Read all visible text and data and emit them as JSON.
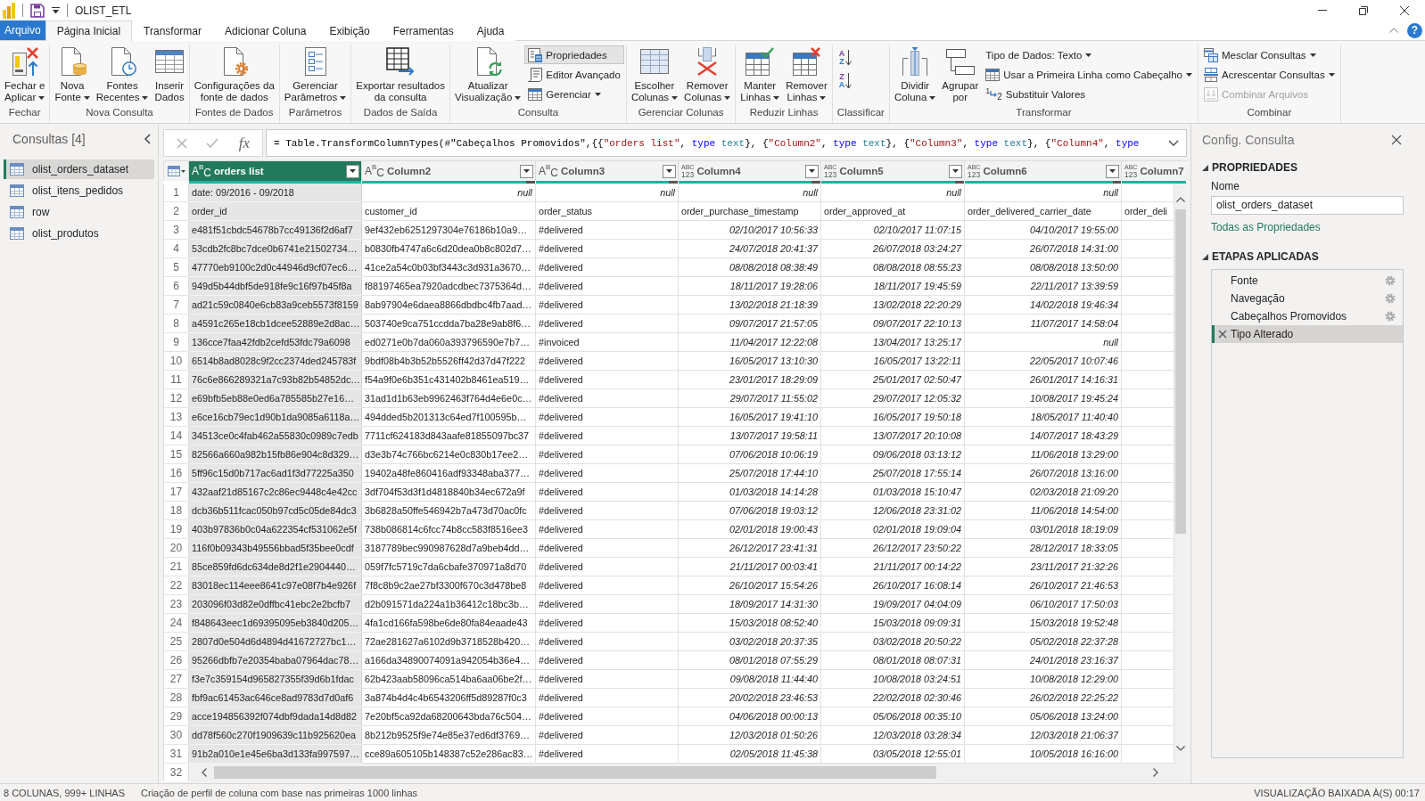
{
  "window": {
    "title": "OLIST_ETL"
  },
  "ribbon": {
    "tabs": [
      {
        "label": "Arquivo",
        "kind": "file",
        "selected": false
      },
      {
        "label": "Página Inicial",
        "kind": "tab",
        "selected": true
      },
      {
        "label": "Transformar",
        "kind": "tab",
        "selected": false
      },
      {
        "label": "Adicionar Coluna",
        "kind": "tab",
        "selected": false
      },
      {
        "label": "Exibição",
        "kind": "tab",
        "selected": false
      },
      {
        "label": "Ferramentas",
        "kind": "tab",
        "selected": false
      },
      {
        "label": "Ajuda",
        "kind": "tab",
        "selected": false
      }
    ],
    "help_symbol": "?",
    "groups": [
      {
        "label": "Fechar",
        "commands": [
          {
            "kind": "large",
            "lines": [
              "Fechar e",
              "Aplicar"
            ],
            "dropdown": true,
            "disabled": false,
            "highlighted": false
          }
        ]
      },
      {
        "label": "Nova Consulta",
        "commands": [
          {
            "kind": "large",
            "lines": [
              "Nova",
              "Fonte"
            ],
            "dropdown": true,
            "disabled": false,
            "highlighted": false
          },
          {
            "kind": "large",
            "lines": [
              "Fontes",
              "Recentes"
            ],
            "dropdown": true,
            "disabled": false,
            "highlighted": false
          },
          {
            "kind": "large",
            "lines": [
              "Inserir",
              "Dados"
            ],
            "dropdown": false,
            "disabled": false,
            "highlighted": false
          }
        ]
      },
      {
        "label": "Fontes de Dados",
        "commands": [
          {
            "kind": "large",
            "lines": [
              "Configurações da",
              "fonte de dados"
            ],
            "dropdown": false,
            "disabled": false,
            "highlighted": false
          }
        ]
      },
      {
        "label": "Parâmetros",
        "commands": [
          {
            "kind": "large",
            "lines": [
              "Gerenciar",
              "Parâmetros"
            ],
            "dropdown": true,
            "disabled": false,
            "highlighted": false
          }
        ]
      },
      {
        "label": "Dados de Saída",
        "commands": [
          {
            "kind": "large",
            "lines": [
              "Exportar resultados",
              "da consulta"
            ],
            "dropdown": false,
            "disabled": false,
            "highlighted": false
          }
        ]
      },
      {
        "label": "Consulta",
        "commands": [
          {
            "kind": "large",
            "lines": [
              "Atualizar",
              "Visualização"
            ],
            "dropdown": true,
            "disabled": false,
            "highlighted": false
          },
          {
            "kind": "small",
            "label": "Propriedades",
            "dropdown": false,
            "disabled": false,
            "highlighted": true
          },
          {
            "kind": "small",
            "label": "Editor Avançado",
            "dropdown": false,
            "disabled": false,
            "highlighted": false
          },
          {
            "kind": "small",
            "label": "Gerenciar",
            "dropdown": true,
            "disabled": false,
            "highlighted": false
          }
        ]
      },
      {
        "label": "Gerenciar Colunas",
        "commands": [
          {
            "kind": "large",
            "lines": [
              "Escolher",
              "Colunas"
            ],
            "dropdown": true,
            "disabled": false,
            "highlighted": false
          },
          {
            "kind": "large",
            "lines": [
              "Remover",
              "Colunas"
            ],
            "dropdown": true,
            "disabled": false,
            "highlighted": false
          }
        ]
      },
      {
        "label": "Reduzir Linhas",
        "commands": [
          {
            "kind": "large",
            "lines": [
              "Manter",
              "Linhas"
            ],
            "dropdown": true,
            "disabled": false,
            "highlighted": false
          },
          {
            "kind": "large",
            "lines": [
              "Remover",
              "Linhas"
            ],
            "dropdown": true,
            "disabled": false,
            "highlighted": false
          }
        ]
      },
      {
        "label": "Classificar",
        "commands": [
          {
            "kind": "sort",
            "symbol": "AZ",
            "dropdown": false,
            "disabled": false,
            "highlighted": false
          },
          {
            "kind": "sort",
            "symbol": "ZA",
            "dropdown": false,
            "disabled": false,
            "highlighted": false
          }
        ]
      },
      {
        "label": "Transformar",
        "commands": [
          {
            "kind": "large",
            "lines": [
              "Dividir",
              "Coluna"
            ],
            "dropdown": true,
            "disabled": false,
            "highlighted": false
          },
          {
            "kind": "large",
            "lines": [
              "Agrupar",
              "por"
            ],
            "dropdown": false,
            "disabled": false,
            "highlighted": false
          },
          {
            "kind": "small",
            "label": "Tipo de Dados: Texto",
            "dropdown": true,
            "disabled": false,
            "highlighted": false
          },
          {
            "kind": "small",
            "label": "Usar a Primeira Linha como Cabeçalho",
            "dropdown": true,
            "disabled": false,
            "highlighted": false
          },
          {
            "kind": "small",
            "label": "Substituir Valores",
            "symbol": "12",
            "dropdown": false,
            "disabled": false,
            "highlighted": false
          }
        ]
      },
      {
        "label": "Combinar",
        "commands": [
          {
            "kind": "small",
            "label": "Mesclar Consultas",
            "dropdown": true,
            "disabled": false,
            "highlighted": false
          },
          {
            "kind": "small",
            "label": "Acrescentar Consultas",
            "dropdown": true,
            "disabled": false,
            "highlighted": false
          },
          {
            "kind": "small",
            "label": "Combinar Arquivos",
            "dropdown": false,
            "disabled": true,
            "highlighted": false
          }
        ]
      }
    ]
  },
  "queries_pane": {
    "title": "Consultas [4]",
    "items": [
      {
        "label": "olist_orders_dataset",
        "selected": true
      },
      {
        "label": "olist_itens_pedidos",
        "selected": false
      },
      {
        "label": "row",
        "selected": false
      },
      {
        "label": "olist_produtos",
        "selected": false
      }
    ]
  },
  "formula_bar": {
    "function_symbol": "fx",
    "formula": [
      {
        "text": "= Table.TransformColumnTypes(#\"Cabeçalhos Promovidos\",{{",
        "kind": "plain"
      },
      {
        "text": "\"orders list\"",
        "kind": "string"
      },
      {
        "text": ", ",
        "kind": "plain"
      },
      {
        "text": "type",
        "kind": "keyword"
      },
      {
        "text": " text",
        "kind": "type_name"
      },
      {
        "text": "}, {",
        "kind": "plain"
      },
      {
        "text": "\"Column2\"",
        "kind": "string"
      },
      {
        "text": ", ",
        "kind": "plain"
      },
      {
        "text": "type",
        "kind": "keyword"
      },
      {
        "text": " text",
        "kind": "type_name"
      },
      {
        "text": "}, {",
        "kind": "plain"
      },
      {
        "text": "\"Column3\"",
        "kind": "string"
      },
      {
        "text": ", ",
        "kind": "plain"
      },
      {
        "text": "type",
        "kind": "keyword"
      },
      {
        "text": " text",
        "kind": "type_name"
      },
      {
        "text": "}, {",
        "kind": "plain"
      },
      {
        "text": "\"Column4\"",
        "kind": "string"
      },
      {
        "text": ", ",
        "kind": "plain"
      },
      {
        "text": "type",
        "kind": "keyword"
      }
    ]
  },
  "table": {
    "columns": [
      {
        "name": "orders list",
        "kind": "text",
        "type_symbol": "ABC",
        "selected": true,
        "quality": {
          "level": 1
        }
      },
      {
        "name": "Column2",
        "kind": "text",
        "type_symbol": "ABC",
        "selected": false,
        "quality": {
          "level": 0.95
        }
      },
      {
        "name": "Column3",
        "kind": "text",
        "type_symbol": "ABC",
        "selected": false,
        "quality": {
          "level": 0.94
        }
      },
      {
        "name": "Column4",
        "kind": "any",
        "type_symbol": "ABC 123",
        "selected": false,
        "quality": {
          "level": 0.94
        }
      },
      {
        "name": "Column5",
        "kind": "any",
        "type_symbol": "ABC 123",
        "selected": false,
        "quality": {
          "level": 0.94
        }
      },
      {
        "name": "Column6",
        "kind": "any",
        "type_symbol": "ABC 123",
        "selected": false,
        "quality": {
          "level": 0.95
        }
      }
    ],
    "cut_column": {
      "name": "Column7",
      "kind": "any",
      "type_symbol": "ABC 123",
      "selected": false,
      "quality": {
        "level": 1
      }
    },
    "rows": [
      {
        "number": "1",
        "cells": [
          {
            "text": "date: 09/2016 - 09/2018",
            "kind": "text"
          },
          {
            "text": "null",
            "kind": "null"
          },
          {
            "text": "null",
            "kind": "null"
          },
          {
            "text": "null",
            "kind": "null"
          },
          {
            "text": "null",
            "kind": "null"
          },
          {
            "text": "null",
            "kind": "null"
          }
        ]
      },
      {
        "number": "2",
        "cells": [
          {
            "text": "order_id",
            "kind": "text"
          },
          {
            "text": "customer_id",
            "kind": "text"
          },
          {
            "text": "order_status",
            "kind": "text"
          },
          {
            "text": "order_purchase_timestamp",
            "kind": "text"
          },
          {
            "text": "order_approved_at",
            "kind": "text"
          },
          {
            "text": "order_delivered_carrier_date",
            "kind": "text"
          },
          {
            "text": "order_deli",
            "kind": "text"
          }
        ]
      },
      {
        "number": "3",
        "cells": [
          {
            "text": "e481f51cbdc54678b7cc49136f2d6af7",
            "kind": "text"
          },
          {
            "text": "9ef432eb6251297304e76186b10a9…",
            "kind": "text"
          },
          {
            "text": "#delivered",
            "kind": "text"
          },
          {
            "text": "02/10/2017 10:56:33",
            "kind": "datetime"
          },
          {
            "text": "02/10/2017 11:07:15",
            "kind": "datetime"
          },
          {
            "text": "04/10/2017 19:55:00",
            "kind": "datetime"
          }
        ]
      },
      {
        "number": "4",
        "cells": [
          {
            "text": "53cdb2fc8bc7dce0b6741e21502734…",
            "kind": "text"
          },
          {
            "text": "b0830fb4747a6c6d20dea0b8c802d7…",
            "kind": "text"
          },
          {
            "text": "#delivered",
            "kind": "text"
          },
          {
            "text": "24/07/2018 20:41:37",
            "kind": "datetime"
          },
          {
            "text": "26/07/2018 03:24:27",
            "kind": "datetime"
          },
          {
            "text": "26/07/2018 14:31:00",
            "kind": "datetime"
          }
        ]
      },
      {
        "number": "5",
        "cells": [
          {
            "text": "47770eb9100c2d0c44946d9cf07ec6…",
            "kind": "text"
          },
          {
            "text": "41ce2a54c0b03bf3443c3d931a3670…",
            "kind": "text"
          },
          {
            "text": "#delivered",
            "kind": "text"
          },
          {
            "text": "08/08/2018 08:38:49",
            "kind": "datetime"
          },
          {
            "text": "08/08/2018 08:55:23",
            "kind": "datetime"
          },
          {
            "text": "08/08/2018 13:50:00",
            "kind": "datetime"
          }
        ]
      },
      {
        "number": "6",
        "cells": [
          {
            "text": "949d5b44dbf5de918fe9c16f97b45f8a",
            "kind": "text"
          },
          {
            "text": "f88197465ea7920adcdbec7375364d…",
            "kind": "text"
          },
          {
            "text": "#delivered",
            "kind": "text"
          },
          {
            "text": "18/11/2017 19:28:06",
            "kind": "datetime"
          },
          {
            "text": "18/11/2017 19:45:59",
            "kind": "datetime"
          },
          {
            "text": "22/11/2017 13:39:59",
            "kind": "datetime"
          }
        ]
      },
      {
        "number": "7",
        "cells": [
          {
            "text": "ad21c59c0840e6cb83a9ceb5573f8159",
            "kind": "text"
          },
          {
            "text": "8ab97904e6daea8866dbdbc4fb7aad…",
            "kind": "text"
          },
          {
            "text": "#delivered",
            "kind": "text"
          },
          {
            "text": "13/02/2018 21:18:39",
            "kind": "datetime"
          },
          {
            "text": "13/02/2018 22:20:29",
            "kind": "datetime"
          },
          {
            "text": "14/02/2018 19:46:34",
            "kind": "datetime"
          }
        ]
      },
      {
        "number": "8",
        "cells": [
          {
            "text": "a4591c265e18cb1dcee52889e2d8ac…",
            "kind": "text"
          },
          {
            "text": "503740e9ca751ccdda7ba28e9ab8f6…",
            "kind": "text"
          },
          {
            "text": "#delivered",
            "kind": "text"
          },
          {
            "text": "09/07/2017 21:57:05",
            "kind": "datetime"
          },
          {
            "text": "09/07/2017 22:10:13",
            "kind": "datetime"
          },
          {
            "text": "11/07/2017 14:58:04",
            "kind": "datetime"
          }
        ]
      },
      {
        "number": "9",
        "cells": [
          {
            "text": "136cce7faa42fdb2cefd53fdc79a6098",
            "kind": "text"
          },
          {
            "text": "ed0271e0b7da060a393796590e7b7…",
            "kind": "text"
          },
          {
            "text": "#invoiced",
            "kind": "text"
          },
          {
            "text": "11/04/2017 12:22:08",
            "kind": "datetime"
          },
          {
            "text": "13/04/2017 13:25:17",
            "kind": "datetime"
          },
          {
            "text": "null",
            "kind": "null"
          }
        ]
      },
      {
        "number": "10",
        "cells": [
          {
            "text": "6514b8ad8028c9f2cc2374ded245783f",
            "kind": "text"
          },
          {
            "text": "9bdf08b4b3b52b5526ff42d37d47f222",
            "kind": "text"
          },
          {
            "text": "#delivered",
            "kind": "text"
          },
          {
            "text": "16/05/2017 13:10:30",
            "kind": "datetime"
          },
          {
            "text": "16/05/2017 13:22:11",
            "kind": "datetime"
          },
          {
            "text": "22/05/2017 10:07:46",
            "kind": "datetime"
          }
        ]
      },
      {
        "number": "11",
        "cells": [
          {
            "text": "76c6e866289321a7c93b82b54852dc…",
            "kind": "text"
          },
          {
            "text": "f54a9f0e6b351c431402b8461ea519…",
            "kind": "text"
          },
          {
            "text": "#delivered",
            "kind": "text"
          },
          {
            "text": "23/01/2017 18:29:09",
            "kind": "datetime"
          },
          {
            "text": "25/01/2017 02:50:47",
            "kind": "datetime"
          },
          {
            "text": "26/01/2017 14:16:31",
            "kind": "datetime"
          }
        ]
      },
      {
        "number": "12",
        "cells": [
          {
            "text": "e69bfb5eb88e0ed6a785585b27e16…",
            "kind": "text"
          },
          {
            "text": "31ad1d1b63eb9962463f764d4e6e0c…",
            "kind": "text"
          },
          {
            "text": "#delivered",
            "kind": "text"
          },
          {
            "text": "29/07/2017 11:55:02",
            "kind": "datetime"
          },
          {
            "text": "29/07/2017 12:05:32",
            "kind": "datetime"
          },
          {
            "text": "10/08/2017 19:45:24",
            "kind": "datetime"
          }
        ]
      },
      {
        "number": "13",
        "cells": [
          {
            "text": "e6ce16cb79ec1d90b1da9085a6118a…",
            "kind": "text"
          },
          {
            "text": "494dded5b201313c64ed7f100595b…",
            "kind": "text"
          },
          {
            "text": "#delivered",
            "kind": "text"
          },
          {
            "text": "16/05/2017 19:41:10",
            "kind": "datetime"
          },
          {
            "text": "16/05/2017 19:50:18",
            "kind": "datetime"
          },
          {
            "text": "18/05/2017 11:40:40",
            "kind": "datetime"
          }
        ]
      },
      {
        "number": "14",
        "cells": [
          {
            "text": "34513ce0c4fab462a55830c0989c7edb",
            "kind": "text"
          },
          {
            "text": "7711cf624183d843aafe81855097bc37",
            "kind": "text"
          },
          {
            "text": "#delivered",
            "kind": "text"
          },
          {
            "text": "13/07/2017 19:58:11",
            "kind": "datetime"
          },
          {
            "text": "13/07/2017 20:10:08",
            "kind": "datetime"
          },
          {
            "text": "14/07/2017 18:43:29",
            "kind": "datetime"
          }
        ]
      },
      {
        "number": "15",
        "cells": [
          {
            "text": "82566a660a982b15fb86e904c8d329…",
            "kind": "text"
          },
          {
            "text": "d3e3b74c766bc6214e0c830b17ee2…",
            "kind": "text"
          },
          {
            "text": "#delivered",
            "kind": "text"
          },
          {
            "text": "07/06/2018 10:06:19",
            "kind": "datetime"
          },
          {
            "text": "09/06/2018 03:13:12",
            "kind": "datetime"
          },
          {
            "text": "11/06/2018 13:29:00",
            "kind": "datetime"
          }
        ]
      },
      {
        "number": "16",
        "cells": [
          {
            "text": "5ff96c15d0b717ac6ad1f3d77225a350",
            "kind": "text"
          },
          {
            "text": "19402a48fe860416adf93348aba377…",
            "kind": "text"
          },
          {
            "text": "#delivered",
            "kind": "text"
          },
          {
            "text": "25/07/2018 17:44:10",
            "kind": "datetime"
          },
          {
            "text": "25/07/2018 17:55:14",
            "kind": "datetime"
          },
          {
            "text": "26/07/2018 13:16:00",
            "kind": "datetime"
          }
        ]
      },
      {
        "number": "17",
        "cells": [
          {
            "text": "432aaf21d85167c2c86ec9448c4e42cc",
            "kind": "text"
          },
          {
            "text": "3df704f53d3f1d4818840b34ec672a9f",
            "kind": "text"
          },
          {
            "text": "#delivered",
            "kind": "text"
          },
          {
            "text": "01/03/2018 14:14:28",
            "kind": "datetime"
          },
          {
            "text": "01/03/2018 15:10:47",
            "kind": "datetime"
          },
          {
            "text": "02/03/2018 21:09:20",
            "kind": "datetime"
          }
        ]
      },
      {
        "number": "18",
        "cells": [
          {
            "text": "dcb36b511fcac050b97cd5c05de84dc3",
            "kind": "text"
          },
          {
            "text": "3b6828a50ffe546942b7a473d70ac0fc",
            "kind": "text"
          },
          {
            "text": "#delivered",
            "kind": "text"
          },
          {
            "text": "07/06/2018 19:03:12",
            "kind": "datetime"
          },
          {
            "text": "12/06/2018 23:31:02",
            "kind": "datetime"
          },
          {
            "text": "11/06/2018 14:54:00",
            "kind": "datetime"
          }
        ]
      },
      {
        "number": "19",
        "cells": [
          {
            "text": "403b97836b0c04a622354cf531062e5f",
            "kind": "text"
          },
          {
            "text": "738b086814c6fcc74b8cc583f8516ee3",
            "kind": "text"
          },
          {
            "text": "#delivered",
            "kind": "text"
          },
          {
            "text": "02/01/2018 19:00:43",
            "kind": "datetime"
          },
          {
            "text": "02/01/2018 19:09:04",
            "kind": "datetime"
          },
          {
            "text": "03/01/2018 18:19:09",
            "kind": "datetime"
          }
        ]
      },
      {
        "number": "20",
        "cells": [
          {
            "text": "116f0b09343b49556bbad5f35bee0cdf",
            "kind": "text"
          },
          {
            "text": "3187789bec990987628d7a9beb4dd…",
            "kind": "text"
          },
          {
            "text": "#delivered",
            "kind": "text"
          },
          {
            "text": "26/12/2017 23:41:31",
            "kind": "datetime"
          },
          {
            "text": "26/12/2017 23:50:22",
            "kind": "datetime"
          },
          {
            "text": "28/12/2017 18:33:05",
            "kind": "datetime"
          }
        ]
      },
      {
        "number": "21",
        "cells": [
          {
            "text": "85ce859fd6dc634de8d2f1e2904440…",
            "kind": "text"
          },
          {
            "text": "059f7fc5719c7da6cbafe370971a8d70",
            "kind": "text"
          },
          {
            "text": "#delivered",
            "kind": "text"
          },
          {
            "text": "21/11/2017 00:03:41",
            "kind": "datetime"
          },
          {
            "text": "21/11/2017 00:14:22",
            "kind": "datetime"
          },
          {
            "text": "23/11/2017 21:32:26",
            "kind": "datetime"
          }
        ]
      },
      {
        "number": "22",
        "cells": [
          {
            "text": "83018ec114eee8641c97e08f7b4e926f",
            "kind": "text"
          },
          {
            "text": "7f8c8b9c2ae27bf3300f670c3d478be8",
            "kind": "text"
          },
          {
            "text": "#delivered",
            "kind": "text"
          },
          {
            "text": "26/10/2017 15:54:26",
            "kind": "datetime"
          },
          {
            "text": "26/10/2017 16:08:14",
            "kind": "datetime"
          },
          {
            "text": "26/10/2017 21:46:53",
            "kind": "datetime"
          }
        ]
      },
      {
        "number": "23",
        "cells": [
          {
            "text": "203096f03d82e0dffbc41ebc2e2bcfb7",
            "kind": "text"
          },
          {
            "text": "d2b091571da224a1b36412c18bc3b…",
            "kind": "text"
          },
          {
            "text": "#delivered",
            "kind": "text"
          },
          {
            "text": "18/09/2017 14:31:30",
            "kind": "datetime"
          },
          {
            "text": "19/09/2017 04:04:09",
            "kind": "datetime"
          },
          {
            "text": "06/10/2017 17:50:03",
            "kind": "datetime"
          }
        ]
      },
      {
        "number": "24",
        "cells": [
          {
            "text": "f848643eec1d69395095eb3840d205…",
            "kind": "text"
          },
          {
            "text": "4fa1cd166fa598be6de80fa84eaade43",
            "kind": "text"
          },
          {
            "text": "#delivered",
            "kind": "text"
          },
          {
            "text": "15/03/2018 08:52:40",
            "kind": "datetime"
          },
          {
            "text": "15/03/2018 09:09:31",
            "kind": "datetime"
          },
          {
            "text": "15/03/2018 19:52:48",
            "kind": "datetime"
          }
        ]
      },
      {
        "number": "25",
        "cells": [
          {
            "text": "2807d0e504d6d4894d41672727bc1…",
            "kind": "text"
          },
          {
            "text": "72ae281627a6102d9b3718528b420…",
            "kind": "text"
          },
          {
            "text": "#delivered",
            "kind": "text"
          },
          {
            "text": "03/02/2018 20:37:35",
            "kind": "datetime"
          },
          {
            "text": "03/02/2018 20:50:22",
            "kind": "datetime"
          },
          {
            "text": "05/02/2018 22:37:28",
            "kind": "datetime"
          }
        ]
      },
      {
        "number": "26",
        "cells": [
          {
            "text": "95266dbfb7e20354baba07964dac78…",
            "kind": "text"
          },
          {
            "text": "a166da34890074091a942054b36e4…",
            "kind": "text"
          },
          {
            "text": "#delivered",
            "kind": "text"
          },
          {
            "text": "08/01/2018 07:55:29",
            "kind": "datetime"
          },
          {
            "text": "08/01/2018 08:07:31",
            "kind": "datetime"
          },
          {
            "text": "24/01/2018 23:16:37",
            "kind": "datetime"
          }
        ]
      },
      {
        "number": "27",
        "cells": [
          {
            "text": "f3e7c359154d965827355f39d6b1fdac",
            "kind": "text"
          },
          {
            "text": "62b423aab58096ca514ba6aa06be2f…",
            "kind": "text"
          },
          {
            "text": "#delivered",
            "kind": "text"
          },
          {
            "text": "09/08/2018 11:44:40",
            "kind": "datetime"
          },
          {
            "text": "10/08/2018 03:24:51",
            "kind": "datetime"
          },
          {
            "text": "10/08/2018 12:29:00",
            "kind": "datetime"
          }
        ]
      },
      {
        "number": "28",
        "cells": [
          {
            "text": "fbf9ac61453ac646ce8ad9783d7d0af6",
            "kind": "text"
          },
          {
            "text": "3a874b4d4c4b6543206ff5d89287f0c3",
            "kind": "text"
          },
          {
            "text": "#delivered",
            "kind": "text"
          },
          {
            "text": "20/02/2018 23:46:53",
            "kind": "datetime"
          },
          {
            "text": "22/02/2018 02:30:46",
            "kind": "datetime"
          },
          {
            "text": "26/02/2018 22:25:22",
            "kind": "datetime"
          }
        ]
      },
      {
        "number": "29",
        "cells": [
          {
            "text": "acce194856392f074dbf9dada14d8d82",
            "kind": "text"
          },
          {
            "text": "7e20bf5ca92da68200643bda76c504…",
            "kind": "text"
          },
          {
            "text": "#delivered",
            "kind": "text"
          },
          {
            "text": "04/06/2018 00:00:13",
            "kind": "datetime"
          },
          {
            "text": "05/06/2018 00:35:10",
            "kind": "datetime"
          },
          {
            "text": "05/06/2018 13:24:00",
            "kind": "datetime"
          }
        ]
      },
      {
        "number": "30",
        "cells": [
          {
            "text": "dd78f560c270f1909639c11b925620ea",
            "kind": "text"
          },
          {
            "text": "8b212b9525f9e74e85e37ed6df3769…",
            "kind": "text"
          },
          {
            "text": "#delivered",
            "kind": "text"
          },
          {
            "text": "12/03/2018 01:50:26",
            "kind": "datetime"
          },
          {
            "text": "12/03/2018 03:28:34",
            "kind": "datetime"
          },
          {
            "text": "12/03/2018 21:06:37",
            "kind": "datetime"
          }
        ]
      },
      {
        "number": "31",
        "cells": [
          {
            "text": "91b2a010e1e45e6ba3d133fa997597…",
            "kind": "text"
          },
          {
            "text": "cce89a605105b148387c52e286ac83…",
            "kind": "text"
          },
          {
            "text": "#delivered",
            "kind": "text"
          },
          {
            "text": "02/05/2018 11:45:38",
            "kind": "datetime"
          },
          {
            "text": "03/05/2018 12:55:01",
            "kind": "datetime"
          },
          {
            "text": "10/05/2018 16:16:00",
            "kind": "datetime"
          }
        ]
      }
    ],
    "partial_row": {
      "number": "32"
    }
  },
  "query_settings": {
    "title": "Config. Consulta",
    "properties": {
      "heading": "PROPRIEDADES",
      "expanded": true,
      "name_label": "Nome",
      "name_value": "olist_orders_dataset",
      "link": "Todas as Propriedades"
    },
    "applied_steps": {
      "heading": "ETAPAS APLICADAS",
      "expanded": true,
      "steps": [
        {
          "label": "Fonte",
          "settings": true,
          "selected": false
        },
        {
          "label": "Navegação",
          "settings": true,
          "selected": false
        },
        {
          "label": "Cabeçalhos Promovidos",
          "settings": true,
          "selected": false
        },
        {
          "label": "Tipo Alterado",
          "settings": false,
          "selected": true
        }
      ]
    }
  },
  "status_bar": {
    "summary": "8 COLUNAS, 999+ LINHAS",
    "profiling": "Criação de perfil de coluna com base nas primeiras 1000 linhas",
    "preview": "VISUALIZAÇÃO BAIXADA À(S) 00:17"
  }
}
